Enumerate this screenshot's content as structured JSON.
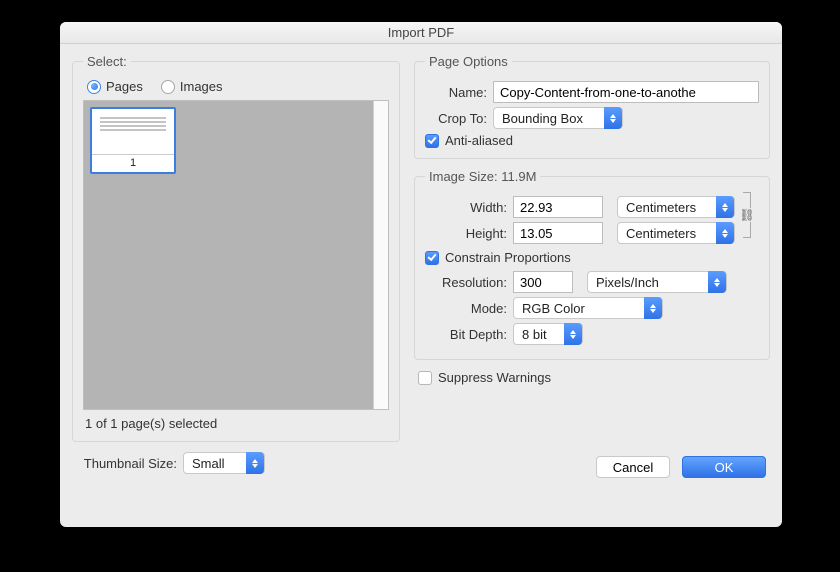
{
  "title": "Import PDF",
  "select": {
    "legend": "Select:",
    "pages_label": "Pages",
    "images_label": "Images",
    "selected_radio": "pages",
    "thumbnail_number": "1",
    "status": "1 of 1 page(s) selected",
    "thumbnail_size_label": "Thumbnail Size:",
    "thumbnail_size_value": "Small"
  },
  "page_options": {
    "legend": "Page Options",
    "name_label": "Name:",
    "name_value": "Copy-Content-from-one-to-anothe",
    "crop_to_label": "Crop To:",
    "crop_to_value": "Bounding Box",
    "anti_aliased_label": "Anti-aliased",
    "anti_aliased_checked": true
  },
  "image_size": {
    "legend": "Image Size: 11.9M",
    "width_label": "Width:",
    "width_value": "22.93",
    "width_unit": "Centimeters",
    "height_label": "Height:",
    "height_value": "13.05",
    "height_unit": "Centimeters",
    "constrain_label": "Constrain Proportions",
    "constrain_checked": true,
    "resolution_label": "Resolution:",
    "resolution_value": "300",
    "resolution_unit": "Pixels/Inch",
    "mode_label": "Mode:",
    "mode_value": "RGB Color",
    "bit_depth_label": "Bit Depth:",
    "bit_depth_value": "8 bit"
  },
  "suppress_warnings": {
    "label": "Suppress Warnings",
    "checked": false
  },
  "buttons": {
    "cancel": "Cancel",
    "ok": "OK"
  }
}
